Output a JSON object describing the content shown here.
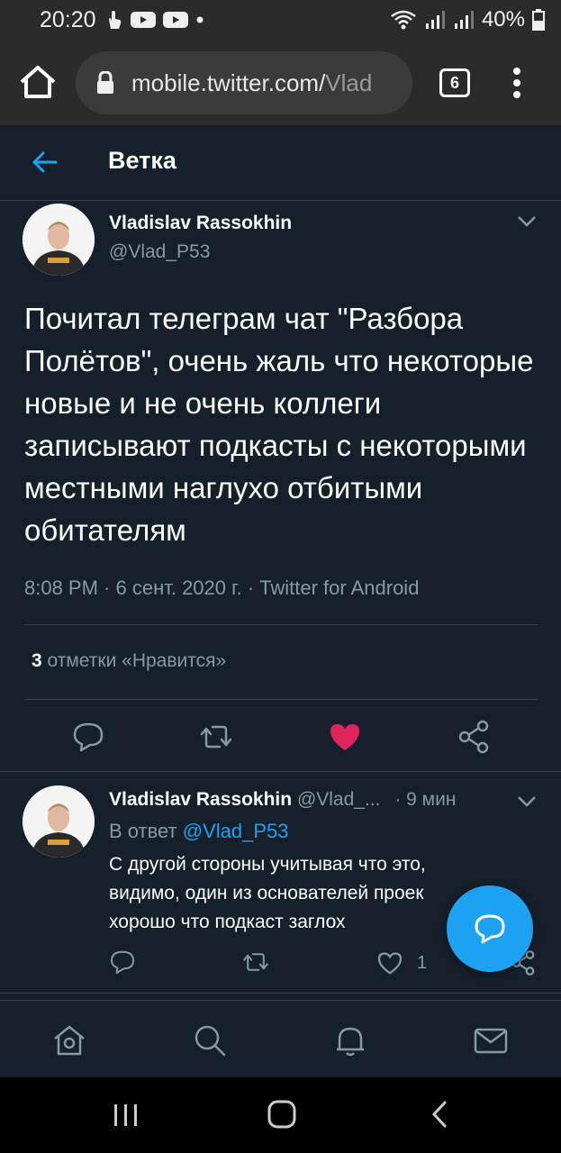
{
  "status_bar": {
    "time": "20:20",
    "battery": "40%"
  },
  "browser": {
    "url": "mobile.twitter.com/",
    "url_tail": "Vlad",
    "tab_count": "6"
  },
  "header": {
    "title": "Ветка"
  },
  "main_tweet": {
    "name": "Vladislav Rassokhin",
    "handle": "@Vlad_P53",
    "text": "Почитал телеграм чат \"Разбора Полётов\", очень жаль что некоторые новые и не очень коллеги записывают подкасты с некоторыми местными наглухо отбитыми обитателям",
    "meta": "8:08 PM · 6 сент. 2020 г. · Twitter for Android",
    "likes_count": "3",
    "likes_label": " отметки «Нравится»"
  },
  "reply_tweet": {
    "name": "Vladislav Rassokhin",
    "handle": "@Vlad_...",
    "time": "· 9 мин",
    "reply_prefix": "В ответ ",
    "reply_mention": "@Vlad_P53",
    "line1": "С другой стороны учитывая что это,",
    "line2": "видимо, один из основателей проек",
    "line3": "хорошо что подкаст заглох",
    "like_count": "1"
  },
  "colors": {
    "background": "#15202b",
    "accent": "#1da1f2",
    "like": "#e0245e",
    "muted": "#8899a6",
    "border": "#38444d"
  },
  "icons": [
    "home-icon",
    "lock-icon",
    "tabs-icon",
    "more-icon",
    "back-arrow-icon",
    "chevron-down-icon",
    "reply-icon",
    "retweet-icon",
    "heart-filled-icon",
    "share-icon",
    "compose-icon",
    "explore-icon",
    "search-icon",
    "notifications-icon",
    "messages-icon",
    "recents-icon",
    "android-home-icon",
    "android-back-icon"
  ]
}
